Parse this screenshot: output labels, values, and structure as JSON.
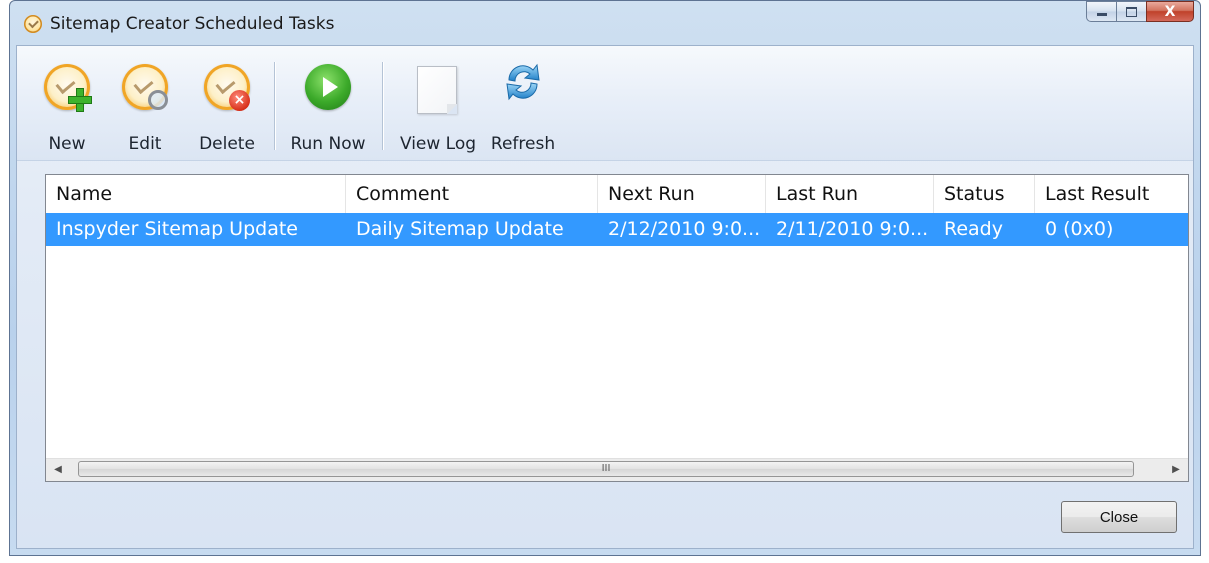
{
  "window": {
    "title": "Sitemap Creator Scheduled Tasks",
    "caption_buttons": {
      "minimize_icon": "minimize-icon",
      "maximize_icon": "maximize-icon",
      "close_glyph": "X"
    }
  },
  "toolbar": {
    "items": [
      {
        "label": "New",
        "icon": "clock-add-icon"
      },
      {
        "label": "Edit",
        "icon": "clock-edit-icon"
      },
      {
        "label": "Delete",
        "icon": "clock-delete-icon"
      },
      {
        "label": "Run Now",
        "icon": "play-icon"
      },
      {
        "label": "View Log",
        "icon": "document-icon"
      },
      {
        "label": "Refresh",
        "icon": "refresh-icon"
      }
    ]
  },
  "task_list": {
    "columns": [
      "Name",
      "Comment",
      "Next Run",
      "Last Run",
      "Status",
      "Last Result"
    ],
    "rows": [
      {
        "name": "Inspyder Sitemap Update",
        "comment": "Daily Sitemap Update",
        "next_run": "2/12/2010 9:0...",
        "last_run": "2/11/2010 9:0...",
        "status": "Ready",
        "last_result": "0 (0x0)",
        "selected": true
      }
    ],
    "scrollbar": {
      "left_arrow": "◀",
      "thumb_grip": "III",
      "right_arrow": "▶"
    }
  },
  "footer": {
    "close_label": "Close"
  },
  "colors": {
    "selection": "#3399ff",
    "window_frame": "#c0d6ee",
    "close_caption": "#c0412a"
  }
}
